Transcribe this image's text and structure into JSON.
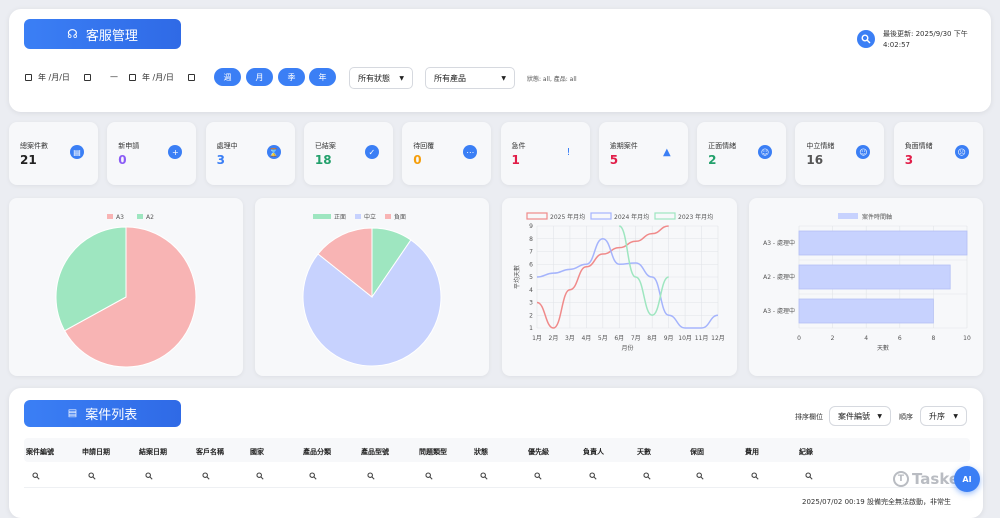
{
  "header": {
    "title": "客服管理",
    "last_update": "最後更新: 2025/9/30 下午",
    "last_update_time": "4:02:57"
  },
  "filters": {
    "date_from": "年 /月/日",
    "date_sep": "—",
    "date_to": "年 /月/日",
    "ranges": [
      "週",
      "月",
      "季",
      "年"
    ],
    "status_select": "所有狀態",
    "product_select": "所有產品",
    "filter_text": "狀態: all, 產品: all"
  },
  "stats": [
    {
      "label": "總案件數",
      "value": "21",
      "icon": "clipboard-icon",
      "color": "#222222",
      "icon_color": "#3b7ff5"
    },
    {
      "label": "新申請",
      "value": "0",
      "icon": "plus-circle-icon",
      "color": "#8b5cf6",
      "icon_color": "#3b7ff5"
    },
    {
      "label": "處理中",
      "value": "3",
      "icon": "hourglass-icon",
      "color": "#3b7ff5",
      "icon_color": "#3b7ff5"
    },
    {
      "label": "已結案",
      "value": "18",
      "icon": "check-circle-icon",
      "color": "#22a06b",
      "icon_color": "#3b7ff5"
    },
    {
      "label": "待回覆",
      "value": "0",
      "icon": "ellipsis-icon",
      "color": "#f59e0b",
      "icon_color": "#3b7ff5"
    },
    {
      "label": "急件",
      "value": "1",
      "icon": "exclamation-icon",
      "color": "#e11d48",
      "icon_color": "#3b7ff5"
    },
    {
      "label": "逾期案件",
      "value": "5",
      "icon": "warning-icon",
      "color": "#e11d48",
      "icon_color": "#3b7ff5"
    },
    {
      "label": "正面情緒",
      "value": "2",
      "icon": "smile-icon",
      "color": "#22a06b",
      "icon_color": "#3b7ff5"
    },
    {
      "label": "中立情緒",
      "value": "16",
      "icon": "neutral-face-icon",
      "color": "#555555",
      "icon_color": "#3b7ff5"
    },
    {
      "label": "負面情緒",
      "value": "3",
      "icon": "frown-icon",
      "color": "#e11d48",
      "icon_color": "#3b7ff5"
    }
  ],
  "chart_data": [
    {
      "type": "pie",
      "labels": [
        "A3",
        "A2"
      ],
      "values": [
        67,
        33
      ],
      "colors": [
        "#f8b4b4",
        "#9ee6c0"
      ],
      "legend": "top"
    },
    {
      "type": "pie",
      "labels": [
        "正面",
        "中立",
        "負面"
      ],
      "values": [
        2,
        16,
        3
      ],
      "colors": [
        "#9ee6c0",
        "#c7d2fe",
        "#f8b4b4"
      ],
      "legend": "top"
    },
    {
      "type": "line",
      "categories": [
        "1月",
        "2月",
        "3月",
        "4月",
        "5月",
        "6月",
        "7月",
        "8月",
        "9月",
        "10月",
        "11月",
        "12月"
      ],
      "series": [
        {
          "name": "2025 年月均",
          "values": [
            3,
            1,
            4,
            5.8,
            6.8,
            7.3,
            7.8,
            8.4,
            9,
            null,
            null,
            null
          ],
          "color": "#f08a8a"
        },
        {
          "name": "2024 年月均",
          "values": [
            5,
            5.3,
            5.6,
            6,
            8,
            6,
            6.1,
            5,
            2,
            1,
            1,
            2
          ],
          "color": "#a5b4fc"
        },
        {
          "name": "2023 年月均",
          "values": [
            null,
            null,
            null,
            null,
            null,
            9,
            5,
            2,
            5,
            null,
            null,
            null
          ],
          "color": "#9ee6c0"
        }
      ],
      "xlabel": "月份",
      "ylabel": "平均天數",
      "ylim": [
        1,
        9
      ],
      "grid": true,
      "legend": "top"
    },
    {
      "type": "bar",
      "orientation": "horizontal",
      "categories": [
        "A3 - 處理中",
        "A2 - 處理中",
        "A3 - 處理中"
      ],
      "values": [
        10,
        9,
        8
      ],
      "series_name": "案件時間軸",
      "color": "#c7d2fe",
      "xlabel": "天數",
      "xlim": [
        0,
        10
      ],
      "xticks": [
        0,
        2,
        4,
        6,
        8,
        10
      ],
      "grid": true,
      "legend": "top"
    }
  ],
  "cases": {
    "title": "案件列表",
    "sort_field_label": "排序欄位",
    "sort_field_value": "案件編號",
    "sort_order_label": "順序",
    "sort_order_value": "升序",
    "columns": [
      "案件編號",
      "申請日期",
      "結案日期",
      "客戶名稱",
      "國家",
      "產品分類",
      "產品型號",
      "問題類型",
      "狀態",
      "優先級",
      "負責人",
      "天數",
      "保固",
      "費用",
      "紀錄"
    ],
    "bottom_note": "2025/07/02 00:19 設備完全無法啟動，非常生"
  },
  "brand": {
    "logo_text": "Tasker",
    "ai_label": "AI"
  }
}
